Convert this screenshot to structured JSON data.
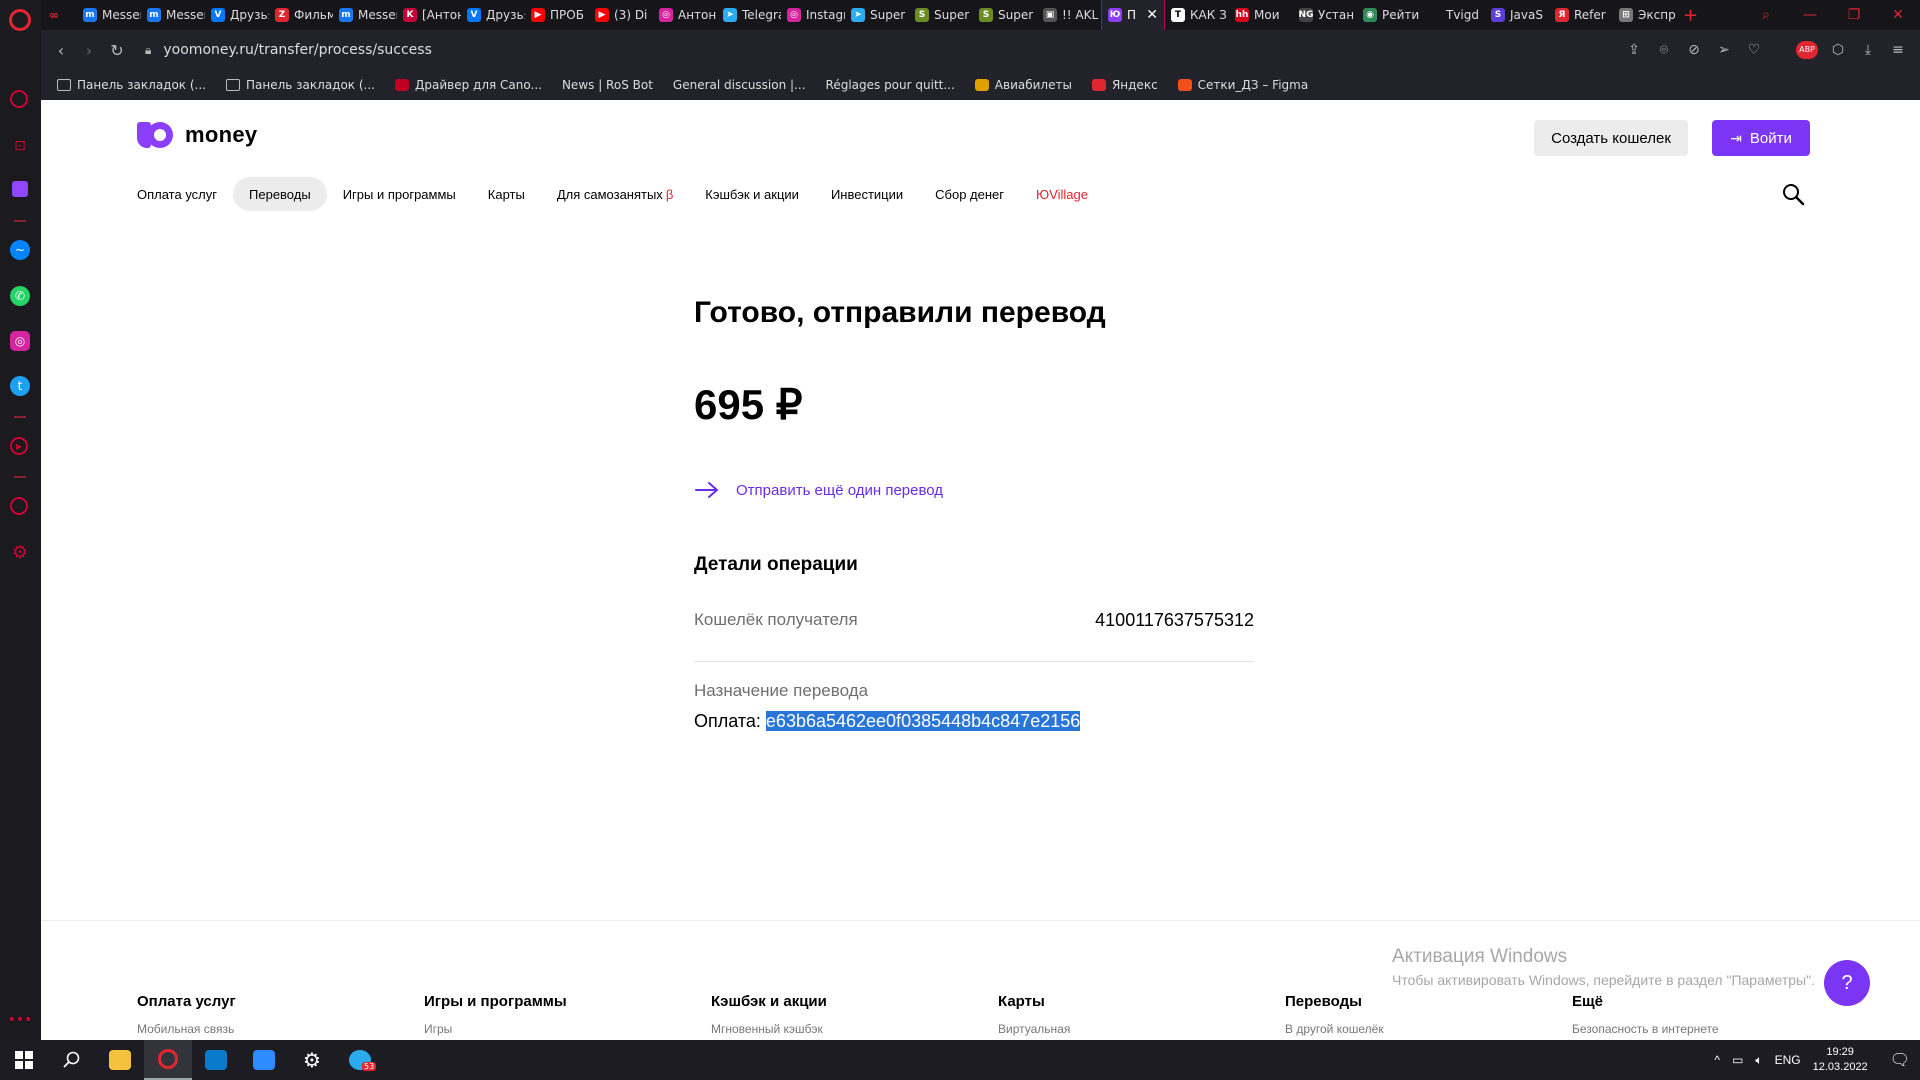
{
  "browser": {
    "tabs": [
      {
        "label": "Messenger",
        "color": "#1877f2",
        "glyph": "m"
      },
      {
        "label": "Messenger",
        "color": "#1877f2",
        "glyph": "m"
      },
      {
        "label": "Друзья",
        "color": "#0077ff",
        "glyph": "V"
      },
      {
        "label": "Фильмы",
        "color": "#e0262f",
        "glyph": "Z"
      },
      {
        "label": "Messenger",
        "color": "#1877f2",
        "glyph": "m"
      },
      {
        "label": "[Антон",
        "color": "#c3003a",
        "glyph": "K"
      },
      {
        "label": "Друзья",
        "color": "#0077ff",
        "glyph": "V"
      },
      {
        "label": "ПРОБ",
        "color": "#ff0000",
        "glyph": "▶"
      },
      {
        "label": "(3) Di",
        "color": "#ff0000",
        "glyph": "▶"
      },
      {
        "label": "Антон",
        "color": "#d6249f",
        "glyph": "◎"
      },
      {
        "label": "Telegram",
        "color": "#2aabee",
        "glyph": "➤"
      },
      {
        "label": "Instagram",
        "color": "#d6249f",
        "glyph": "◎"
      },
      {
        "label": "Super",
        "color": "#2aabee",
        "glyph": "➤"
      },
      {
        "label": "Super",
        "color": "#6b8e23",
        "glyph": "S"
      },
      {
        "label": "Super",
        "color": "#6b8e23",
        "glyph": "S"
      },
      {
        "label": "!! AKL",
        "color": "#555555",
        "glyph": "▣"
      },
      {
        "label": "П",
        "color": "#8b3ffd",
        "glyph": "Ю",
        "active": true
      },
      {
        "label": "КАК З",
        "color": "#ffffff",
        "glyph": "T"
      },
      {
        "label": "Мои",
        "color": "#d6001c",
        "glyph": "hh"
      },
      {
        "label": "Устан",
        "color": "#444444",
        "glyph": "NG"
      },
      {
        "label": "Рейти",
        "color": "#2e8b57",
        "glyph": "◉"
      },
      {
        "label": "Tvigd",
        "color": "#15151a",
        "glyph": ""
      },
      {
        "label": "JavaS",
        "color": "#5b3fd6",
        "glyph": "S"
      },
      {
        "label": "Refer",
        "color": "#e0262f",
        "glyph": "Я"
      },
      {
        "label": "Экспр",
        "color": "#777777",
        "glyph": "⊞"
      }
    ],
    "url": "yoomoney.ru/transfer/process/success",
    "bookmarks": [
      {
        "label": "Панель закладок (...",
        "type": "folder"
      },
      {
        "label": "Панель закладок (...",
        "type": "folder"
      },
      {
        "label": "Драйвер для Cano...",
        "type": "icon",
        "color": "#c00020"
      },
      {
        "label": "News | RoS Bot",
        "type": "none"
      },
      {
        "label": "General discussion |...",
        "type": "none"
      },
      {
        "label": "Réglages pour quitt...",
        "type": "none"
      },
      {
        "label": "Авиабилеты",
        "type": "icon",
        "color": "#e0a000"
      },
      {
        "label": "Яндекс",
        "type": "icon",
        "color": "#e0262f"
      },
      {
        "label": "Сетки_ДЗ – Figma",
        "type": "icon",
        "color": "#f24e1e"
      }
    ]
  },
  "header": {
    "brand": "money",
    "create_wallet": "Создать кошелек",
    "login": "Войти"
  },
  "nav": {
    "items": [
      {
        "label": "Оплата услуг"
      },
      {
        "label": "Переводы",
        "active": true
      },
      {
        "label": "Игры и программы"
      },
      {
        "label": "Карты"
      },
      {
        "label": "Для самозанятых",
        "beta": "β"
      },
      {
        "label": "Кэшбэк и акции"
      },
      {
        "label": "Инвестиции"
      },
      {
        "label": "Сбор денег"
      },
      {
        "label": "ЮVillage",
        "red": true
      }
    ]
  },
  "result": {
    "title": "Готово, отправили перевод",
    "amount": "695 ₽",
    "send_again": "Отправить ещё один перевод",
    "details_title": "Детали операции",
    "wallet_label": "Кошелёк получателя",
    "wallet_value": "4100117637575312",
    "purpose_label": "Назначение перевода",
    "purpose_prefix": "Оплата: ",
    "purpose_code": "e63b6a5462ee0f0385448b4c847e2156"
  },
  "footer": {
    "columns": [
      {
        "title": "Оплата услуг",
        "first": "Мобильная связь"
      },
      {
        "title": "Игры и программы",
        "first": "Игры"
      },
      {
        "title": "Кэшбэк и акции",
        "first": "Мгновенный кэшбэк"
      },
      {
        "title": "Карты",
        "first": "Виртуальная"
      },
      {
        "title": "Переводы",
        "first": "В другой кошелёк"
      },
      {
        "title": "Ещё",
        "first": "Безопасность в интернете"
      }
    ]
  },
  "windows": {
    "activation_title": "Активация Windows",
    "activation_text": "Чтобы активировать Windows, перейдите в раздел \"Параметры\".",
    "lang": "ENG",
    "time": "19:29",
    "date": "12.03.2022",
    "telegram_badge": "53"
  },
  "colors": {
    "brand_purple": "#7b36f5",
    "link_purple": "#6a2ce8",
    "selection_blue": "#2a76d8"
  }
}
